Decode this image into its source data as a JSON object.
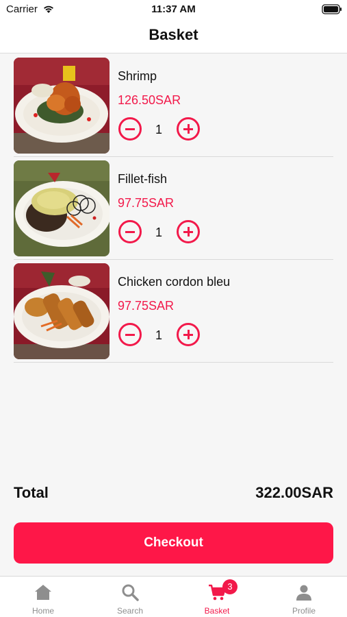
{
  "status_bar": {
    "carrier": "Carrier",
    "time": "11:37 AM"
  },
  "header": {
    "title": "Basket"
  },
  "basket": {
    "items": [
      {
        "name": "Shrimp",
        "price": "126.50SAR",
        "quantity": "1"
      },
      {
        "name": "Fillet-fish",
        "price": "97.75SAR",
        "quantity": "1"
      },
      {
        "name": "Chicken cordon bleu",
        "price": "97.75SAR",
        "quantity": "1"
      }
    ]
  },
  "summary": {
    "total_label": "Total",
    "total_value": "322.00SAR"
  },
  "checkout": {
    "label": "Checkout"
  },
  "tab_bar": {
    "tabs": [
      {
        "label": "Home",
        "icon": "home-icon"
      },
      {
        "label": "Search",
        "icon": "search-icon"
      },
      {
        "label": "Basket",
        "icon": "cart-icon",
        "badge": "3",
        "active": true
      },
      {
        "label": "Profile",
        "icon": "person-icon"
      }
    ]
  },
  "colors": {
    "accent": "#f2194a",
    "checkout_bg": "#fe1748",
    "inactive_tab": "#8e8e8e"
  }
}
